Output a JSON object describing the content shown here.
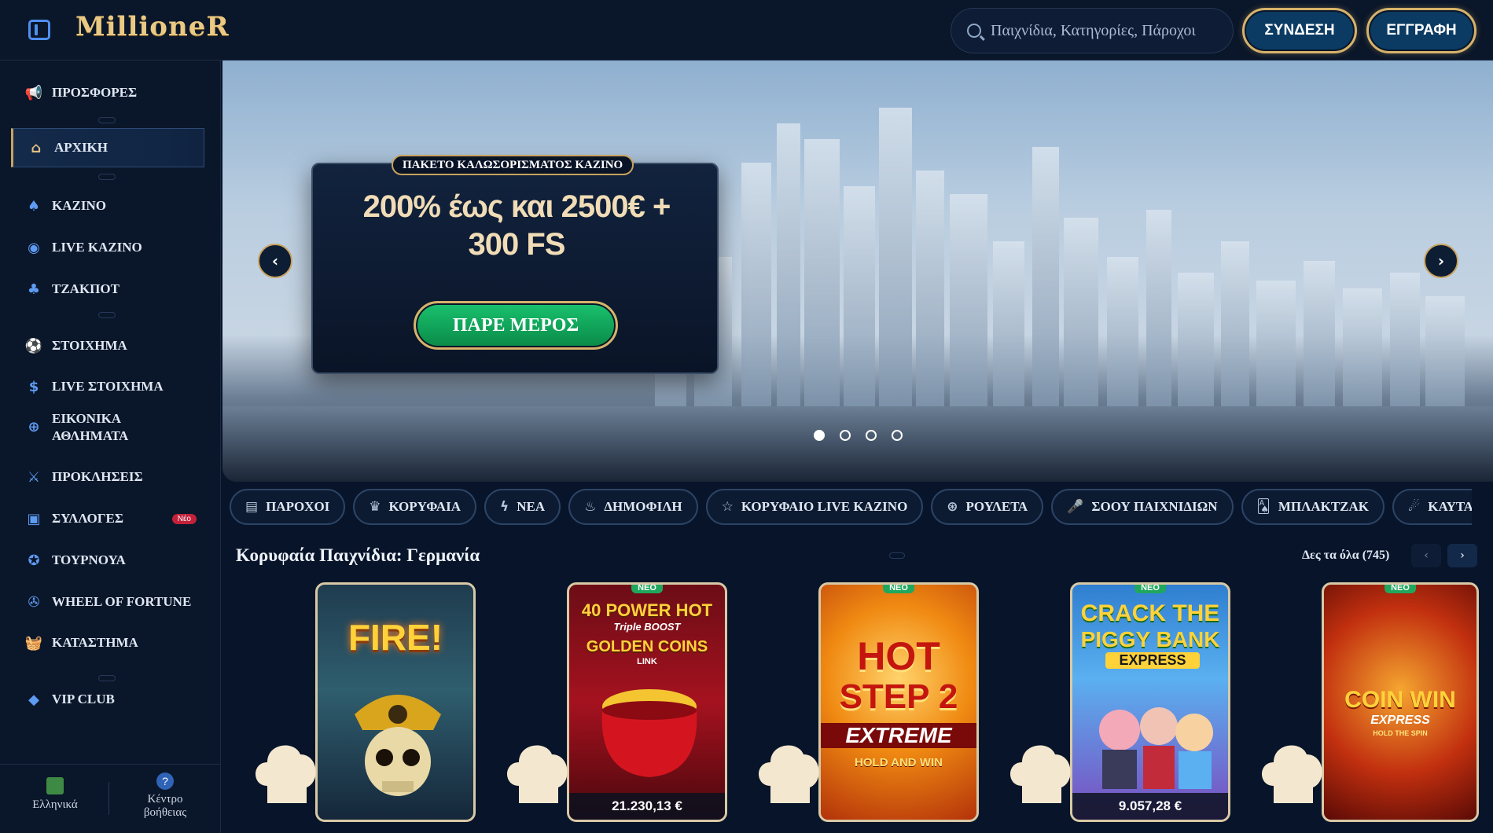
{
  "header": {
    "logo_text": "MillioneR",
    "search_placeholder": "Παιχνίδια, Κατηγορίες, Πάροχοι",
    "login_label": "ΣΥΝΔΕΣΗ",
    "register_label": "ΕΓΓΡΑΦΗ"
  },
  "sidebar": {
    "items": [
      {
        "label": "ΠΡΟΣΦΟΡΕΣ",
        "icon": "megaphone-icon"
      },
      {
        "label": "ΑΡΧΙΚΗ",
        "icon": "home-icon",
        "active": true
      },
      {
        "label": "ΚΑΖΙΝΟ",
        "icon": "spade-icon"
      },
      {
        "label": "LIVE ΚΑΖΙΝΟ",
        "icon": "chip-icon"
      },
      {
        "label": "ΤΖΑΚΠΟΤ",
        "icon": "clover-icon"
      },
      {
        "label": "ΣΤΟΙΧΗΜΑ",
        "icon": "soccer-ball-icon"
      },
      {
        "label": "LIVE ΣΤΟΙΧΗΜΑ",
        "icon": "live-bet-icon"
      },
      {
        "label": "ΕΙΚΟΝΙΚΑ ΑΘΛΗΜΑΤΑ",
        "icon": "virtual-sports-icon"
      },
      {
        "label": "ΠΡΟΚΛΗΣΕΙΣ",
        "icon": "crossed-swords-icon"
      },
      {
        "label": "ΣΥΛΛΟΓΕΣ",
        "icon": "collections-icon",
        "badge": "Νέο"
      },
      {
        "label": "ΤΟΥΡΝΟΥΑ",
        "icon": "medal-icon"
      },
      {
        "label": "WHEEL OF FORTUNE",
        "icon": "wheel-icon"
      },
      {
        "label": "ΚΑΤΑΣΤΗΜΑ",
        "icon": "basket-icon"
      },
      {
        "label": "VIP CLUB",
        "icon": "diamond-icon"
      }
    ],
    "footer": {
      "language_label": "Ελληνικά",
      "help_label": "Κέντρο βοήθειας"
    }
  },
  "hero": {
    "tag": "ΠΑΚΕΤΟ ΚΑΛΩΣΟΡΙΣΜΑΤΟΣ ΚΑΖΙΝΟ",
    "title_line1": "200% έως και 2500€ +",
    "title_line2": "300 FS",
    "cta_label": "ΠΑΡΕ ΜΕΡΟΣ",
    "slides_total": 4,
    "active_slide": 1
  },
  "categories": [
    {
      "label": "ΠΑΡΟΧΟΙ",
      "icon": "book-icon"
    },
    {
      "label": "ΚΟΡΥΦΑΙΑ",
      "icon": "crown-icon"
    },
    {
      "label": "ΝΕΑ",
      "icon": "lightning-icon"
    },
    {
      "label": "ΔΗΜΟΦΙΛΗ",
      "icon": "flame-icon"
    },
    {
      "label": "ΚΟΡΥΦΑΙΟ LIVE ΚΑΖΙΝΟ",
      "icon": "star-icon"
    },
    {
      "label": "ΡΟΥΛΕΤΑ",
      "icon": "roulette-icon"
    },
    {
      "label": "ΣΟΟΥ ΠΑΙΧΝΙΔΙΩΝ",
      "icon": "microphone-icon"
    },
    {
      "label": "ΜΠΛΑΚΤΖΑΚ",
      "icon": "cards-icon"
    },
    {
      "label": "ΚΑΥΤΑ ΤΖΑΚΠΟΤ",
      "icon": "chili-icon"
    }
  ],
  "section": {
    "title": "Κορυφαία Παιχνίδια: Γερμανία",
    "see_all": "Δες τα όλα (745)"
  },
  "games": [
    {
      "rank": "1",
      "art_lines": [
        "FIRE!"
      ],
      "neo": "",
      "jackpot": ""
    },
    {
      "rank": "2",
      "art_lines": [
        "40 POWER HOT",
        "Triple BOOST",
        "GOLDEN COINS",
        "LINK"
      ],
      "neo": "ΝΕΟ",
      "jackpot": "21.230,13 €"
    },
    {
      "rank": "3",
      "art_lines": [
        "HOT",
        "STEP 2",
        "EXTREME",
        "HOLD AND WIN"
      ],
      "neo": "ΝΕΟ",
      "jackpot": ""
    },
    {
      "rank": "4",
      "art_lines": [
        "CRACK THE",
        "PIGGY BANK",
        "EXPRESS"
      ],
      "neo": "ΝΕΟ",
      "jackpot": "9.057,28 €"
    },
    {
      "rank": "5",
      "art_lines": [
        "COIN WIN",
        "EXPRESS",
        "HOLD THE SPIN"
      ],
      "neo": "ΝΕΟ",
      "jackpot": ""
    }
  ],
  "colors": {
    "background": "#07142a",
    "accent_gold": "#d6b26a",
    "accent_blue": "#5e9bf2",
    "cta_green": "#19c26e",
    "badge_red": "#c2213a"
  }
}
